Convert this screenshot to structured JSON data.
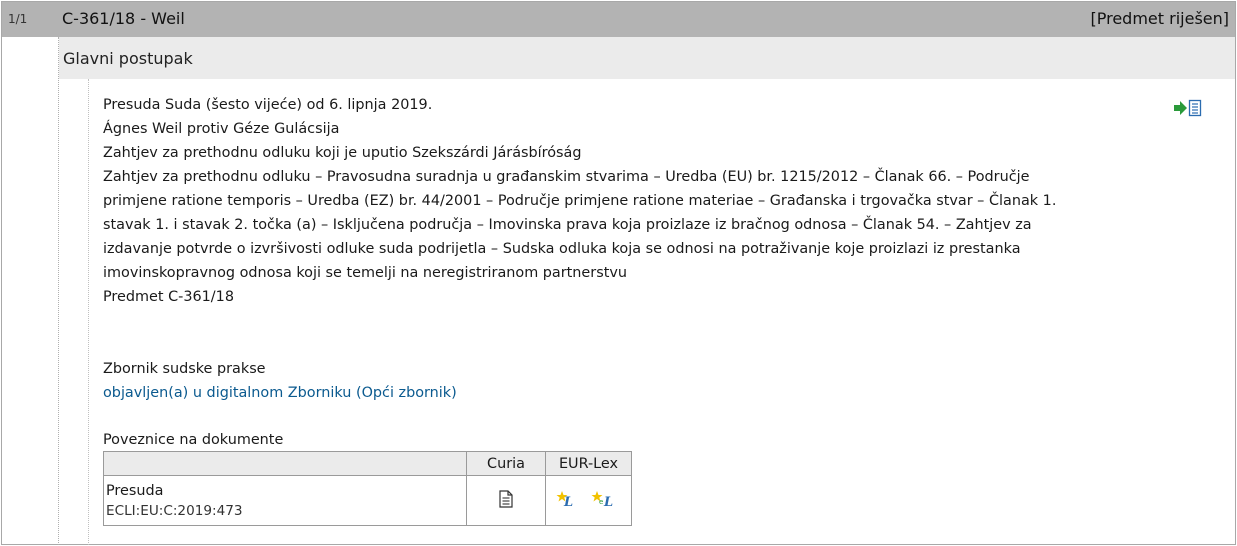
{
  "header": {
    "counter": "1/1",
    "case_title": "C-361/18 - Weil",
    "status": "[Predmet riješen]"
  },
  "procedure": {
    "label": "Glavni postupak"
  },
  "judgment": {
    "lines": [
      "Presuda Suda (šesto vijeće) od 6. lipnja 2019.",
      "Ágnes Weil protiv Géze Gulácsija",
      "Zahtjev za prethodnu odluku koji je uputio Szekszárdi Járásbíróság",
      "Zahtjev za prethodnu odluku – Pravosudna suradnja u građanskim stvarima – Uredba (EU) br. 1215/2012 – Članak 66. – Područje",
      "primjene ratione temporis – Uredba (EZ) br. 44/2001 – Područje primjene ratione materiae – Građanska i trgovačka stvar – Članak 1.",
      "stavak 1. i stavak 2. točka (a) – Isključena područja – Imovinska prava koja proizlaze iz bračnog odnosa – Članak 54. – Zahtjev za",
      "izdavanje potvrde o izvršivosti odluke suda podrijetla – Sudska odluka koja se odnosi na potraživanje koje proizlazi iz prestanka",
      "imovinskopravnog odnosa koji se temelji na neregistriranom partnerstvu",
      "Predmet C-361/18"
    ]
  },
  "zbornik": {
    "label": "Zbornik sudske prakse",
    "link": "objavljen(a) u digitalnom Zborniku (Opći zbornik)"
  },
  "doc_links": {
    "label": "Poveznice na dokumente",
    "headers": [
      "",
      "Curia",
      "EUR-Lex"
    ],
    "rows": [
      {
        "doc_type": "Presuda",
        "ecli": "ECLI:EU:C:2019:473"
      }
    ]
  },
  "icons": {
    "export": "export-list-icon",
    "curia_doc": "document-icon",
    "eurlex_1": "eurlex-icon",
    "eurlex_2": "eurlex-icon"
  },
  "colors": {
    "header_bg": "#b3b3b3",
    "subheader_bg": "#ebebeb",
    "link": "#0b5a8f",
    "icon_green": "#2a9a3a",
    "icon_blue": "#2b6cb0"
  }
}
